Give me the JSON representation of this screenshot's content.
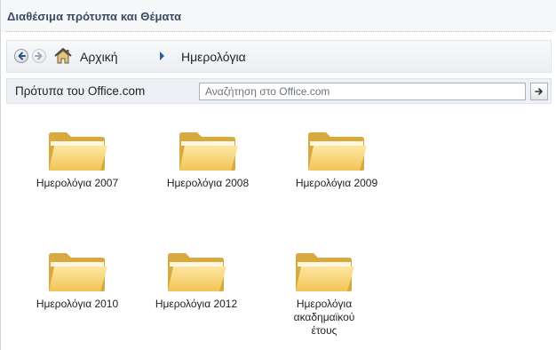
{
  "panel": {
    "title": "Διαθέσιμα πρότυπα και Θέματα"
  },
  "breadcrumb": {
    "home_label": "Αρχική",
    "current_label": "Ημερολόγια"
  },
  "search": {
    "scope_label": "Πρότυπα του Office.com",
    "placeholder": "Αναζήτηση στο Office.com"
  },
  "folders": [
    {
      "label": "Ημερολόγια 2007"
    },
    {
      "label": "Ημερολόγια 2008"
    },
    {
      "label": "Ημερολόγια 2009"
    },
    {
      "label": "Ημερολόγια 2010"
    },
    {
      "label": "Ημερολόγια 2012"
    },
    {
      "label": "Ημερολόγια ακαδημαϊκού έτους"
    }
  ],
  "icons": {
    "back": "back-arrow-icon",
    "forward": "forward-arrow-icon",
    "home": "home-icon",
    "separator": "chevron-right-icon",
    "search_go": "arrow-right-icon",
    "folder": "folder-icon"
  }
}
